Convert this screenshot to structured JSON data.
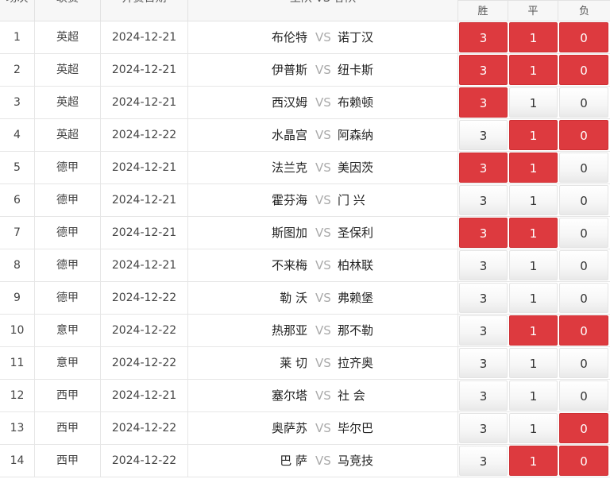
{
  "header": {
    "no": "场次",
    "league": "联赛",
    "date": "开赛日期",
    "match": "主队 VS 客队",
    "win": "胜",
    "draw": "平",
    "lose": "负"
  },
  "vs_label": "VS",
  "rows": [
    {
      "no": "1",
      "league": "英超",
      "date": "2024-12-21",
      "home": "布伦特",
      "away": "诺丁汉",
      "win": "3",
      "draw": "1",
      "lose": "0",
      "sel": [
        true,
        true,
        true
      ]
    },
    {
      "no": "2",
      "league": "英超",
      "date": "2024-12-21",
      "home": "伊普斯",
      "away": "纽卡斯",
      "win": "3",
      "draw": "1",
      "lose": "0",
      "sel": [
        true,
        true,
        true
      ]
    },
    {
      "no": "3",
      "league": "英超",
      "date": "2024-12-21",
      "home": "西汉姆",
      "away": "布赖顿",
      "win": "3",
      "draw": "1",
      "lose": "0",
      "sel": [
        true,
        false,
        false
      ]
    },
    {
      "no": "4",
      "league": "英超",
      "date": "2024-12-22",
      "home": "水晶宫",
      "away": "阿森纳",
      "win": "3",
      "draw": "1",
      "lose": "0",
      "sel": [
        false,
        true,
        true
      ]
    },
    {
      "no": "5",
      "league": "德甲",
      "date": "2024-12-21",
      "home": "法兰克",
      "away": "美因茨",
      "win": "3",
      "draw": "1",
      "lose": "0",
      "sel": [
        true,
        true,
        false
      ]
    },
    {
      "no": "6",
      "league": "德甲",
      "date": "2024-12-21",
      "home": "霍芬海",
      "away": "门 兴",
      "win": "3",
      "draw": "1",
      "lose": "0",
      "sel": [
        false,
        false,
        false
      ]
    },
    {
      "no": "7",
      "league": "德甲",
      "date": "2024-12-21",
      "home": "斯图加",
      "away": "圣保利",
      "win": "3",
      "draw": "1",
      "lose": "0",
      "sel": [
        true,
        true,
        false
      ]
    },
    {
      "no": "8",
      "league": "德甲",
      "date": "2024-12-21",
      "home": "不来梅",
      "away": "柏林联",
      "win": "3",
      "draw": "1",
      "lose": "0",
      "sel": [
        false,
        false,
        false
      ]
    },
    {
      "no": "9",
      "league": "德甲",
      "date": "2024-12-22",
      "home": "勒 沃",
      "away": "弗赖堡",
      "win": "3",
      "draw": "1",
      "lose": "0",
      "sel": [
        false,
        false,
        false
      ]
    },
    {
      "no": "10",
      "league": "意甲",
      "date": "2024-12-22",
      "home": "热那亚",
      "away": "那不勒",
      "win": "3",
      "draw": "1",
      "lose": "0",
      "sel": [
        false,
        true,
        true
      ]
    },
    {
      "no": "11",
      "league": "意甲",
      "date": "2024-12-22",
      "home": "莱 切",
      "away": "拉齐奥",
      "win": "3",
      "draw": "1",
      "lose": "0",
      "sel": [
        false,
        false,
        false
      ]
    },
    {
      "no": "12",
      "league": "西甲",
      "date": "2024-12-21",
      "home": "塞尔塔",
      "away": "社 会",
      "win": "3",
      "draw": "1",
      "lose": "0",
      "sel": [
        false,
        false,
        false
      ]
    },
    {
      "no": "13",
      "league": "西甲",
      "date": "2024-12-22",
      "home": "奥萨苏",
      "away": "毕尔巴",
      "win": "3",
      "draw": "1",
      "lose": "0",
      "sel": [
        false,
        false,
        true
      ]
    },
    {
      "no": "14",
      "league": "西甲",
      "date": "2024-12-22",
      "home": "巴 萨",
      "away": "马竞技",
      "win": "3",
      "draw": "1",
      "lose": "0",
      "sel": [
        false,
        true,
        true
      ]
    }
  ],
  "colors": {
    "selected": "#dd3a3f",
    "border": "#e6e6e6",
    "vs": "#aaaaaa"
  }
}
